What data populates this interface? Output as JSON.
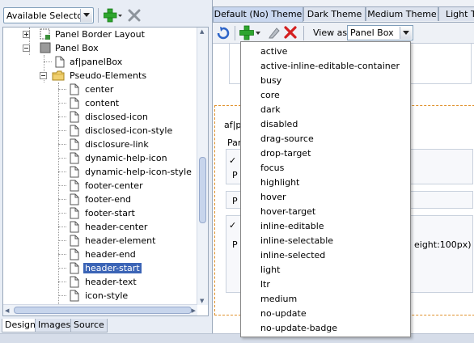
{
  "left_toolbar": {
    "selector_combo": "Available Selectors"
  },
  "tree": {
    "items": [
      {
        "label": "Panel Border Layout"
      },
      {
        "label": "Panel Box"
      },
      {
        "label": "af|panelBox"
      },
      {
        "label": "Pseudo-Elements"
      },
      {
        "label": "center"
      },
      {
        "label": "content"
      },
      {
        "label": "disclosed-icon"
      },
      {
        "label": "disclosed-icon-style"
      },
      {
        "label": "disclosure-link"
      },
      {
        "label": "dynamic-help-icon"
      },
      {
        "label": "dynamic-help-icon-style"
      },
      {
        "label": "footer-center"
      },
      {
        "label": "footer-end"
      },
      {
        "label": "footer-start"
      },
      {
        "label": "header-center"
      },
      {
        "label": "header-element"
      },
      {
        "label": "header-end"
      },
      {
        "label": "header-start"
      },
      {
        "label": "header-text"
      },
      {
        "label": "icon-style"
      }
    ],
    "selected": "header-start"
  },
  "bottom_tabs": [
    "Design",
    "Images",
    "Source"
  ],
  "theme_tabs": [
    "Default (No) Theme",
    "Dark Theme",
    "Medium Theme",
    "Light Th"
  ],
  "right_toolbar": {
    "view_as_label": "View as:",
    "view_as_value": "Panel Box"
  },
  "preview": {
    "text_1": "af|p",
    "text_2": "Pan",
    "text_3": "P",
    "text_4": "P",
    "text_5": "P",
    "text_6": "eight:100px)"
  },
  "dropdown": {
    "items": [
      "active",
      "active-inline-editable-container",
      "busy",
      "core",
      "dark",
      "disabled",
      "drag-source",
      "drop-target",
      "focus",
      "highlight",
      "hover",
      "hover-target",
      "inline-editable",
      "inline-selectable",
      "inline-selected",
      "light",
      "ltr",
      "medium",
      "no-update",
      "no-update-badge"
    ]
  },
  "colors": {
    "selection": "#3b64b6",
    "dashed_border": "#e0912b",
    "add_green": "#2ea52e",
    "delete_red": "#d42020"
  },
  "icons": [
    "chevron-down-icon",
    "add-icon",
    "delete-icon",
    "refresh-icon",
    "edit-icon",
    "folder-icon",
    "document-icon"
  ]
}
